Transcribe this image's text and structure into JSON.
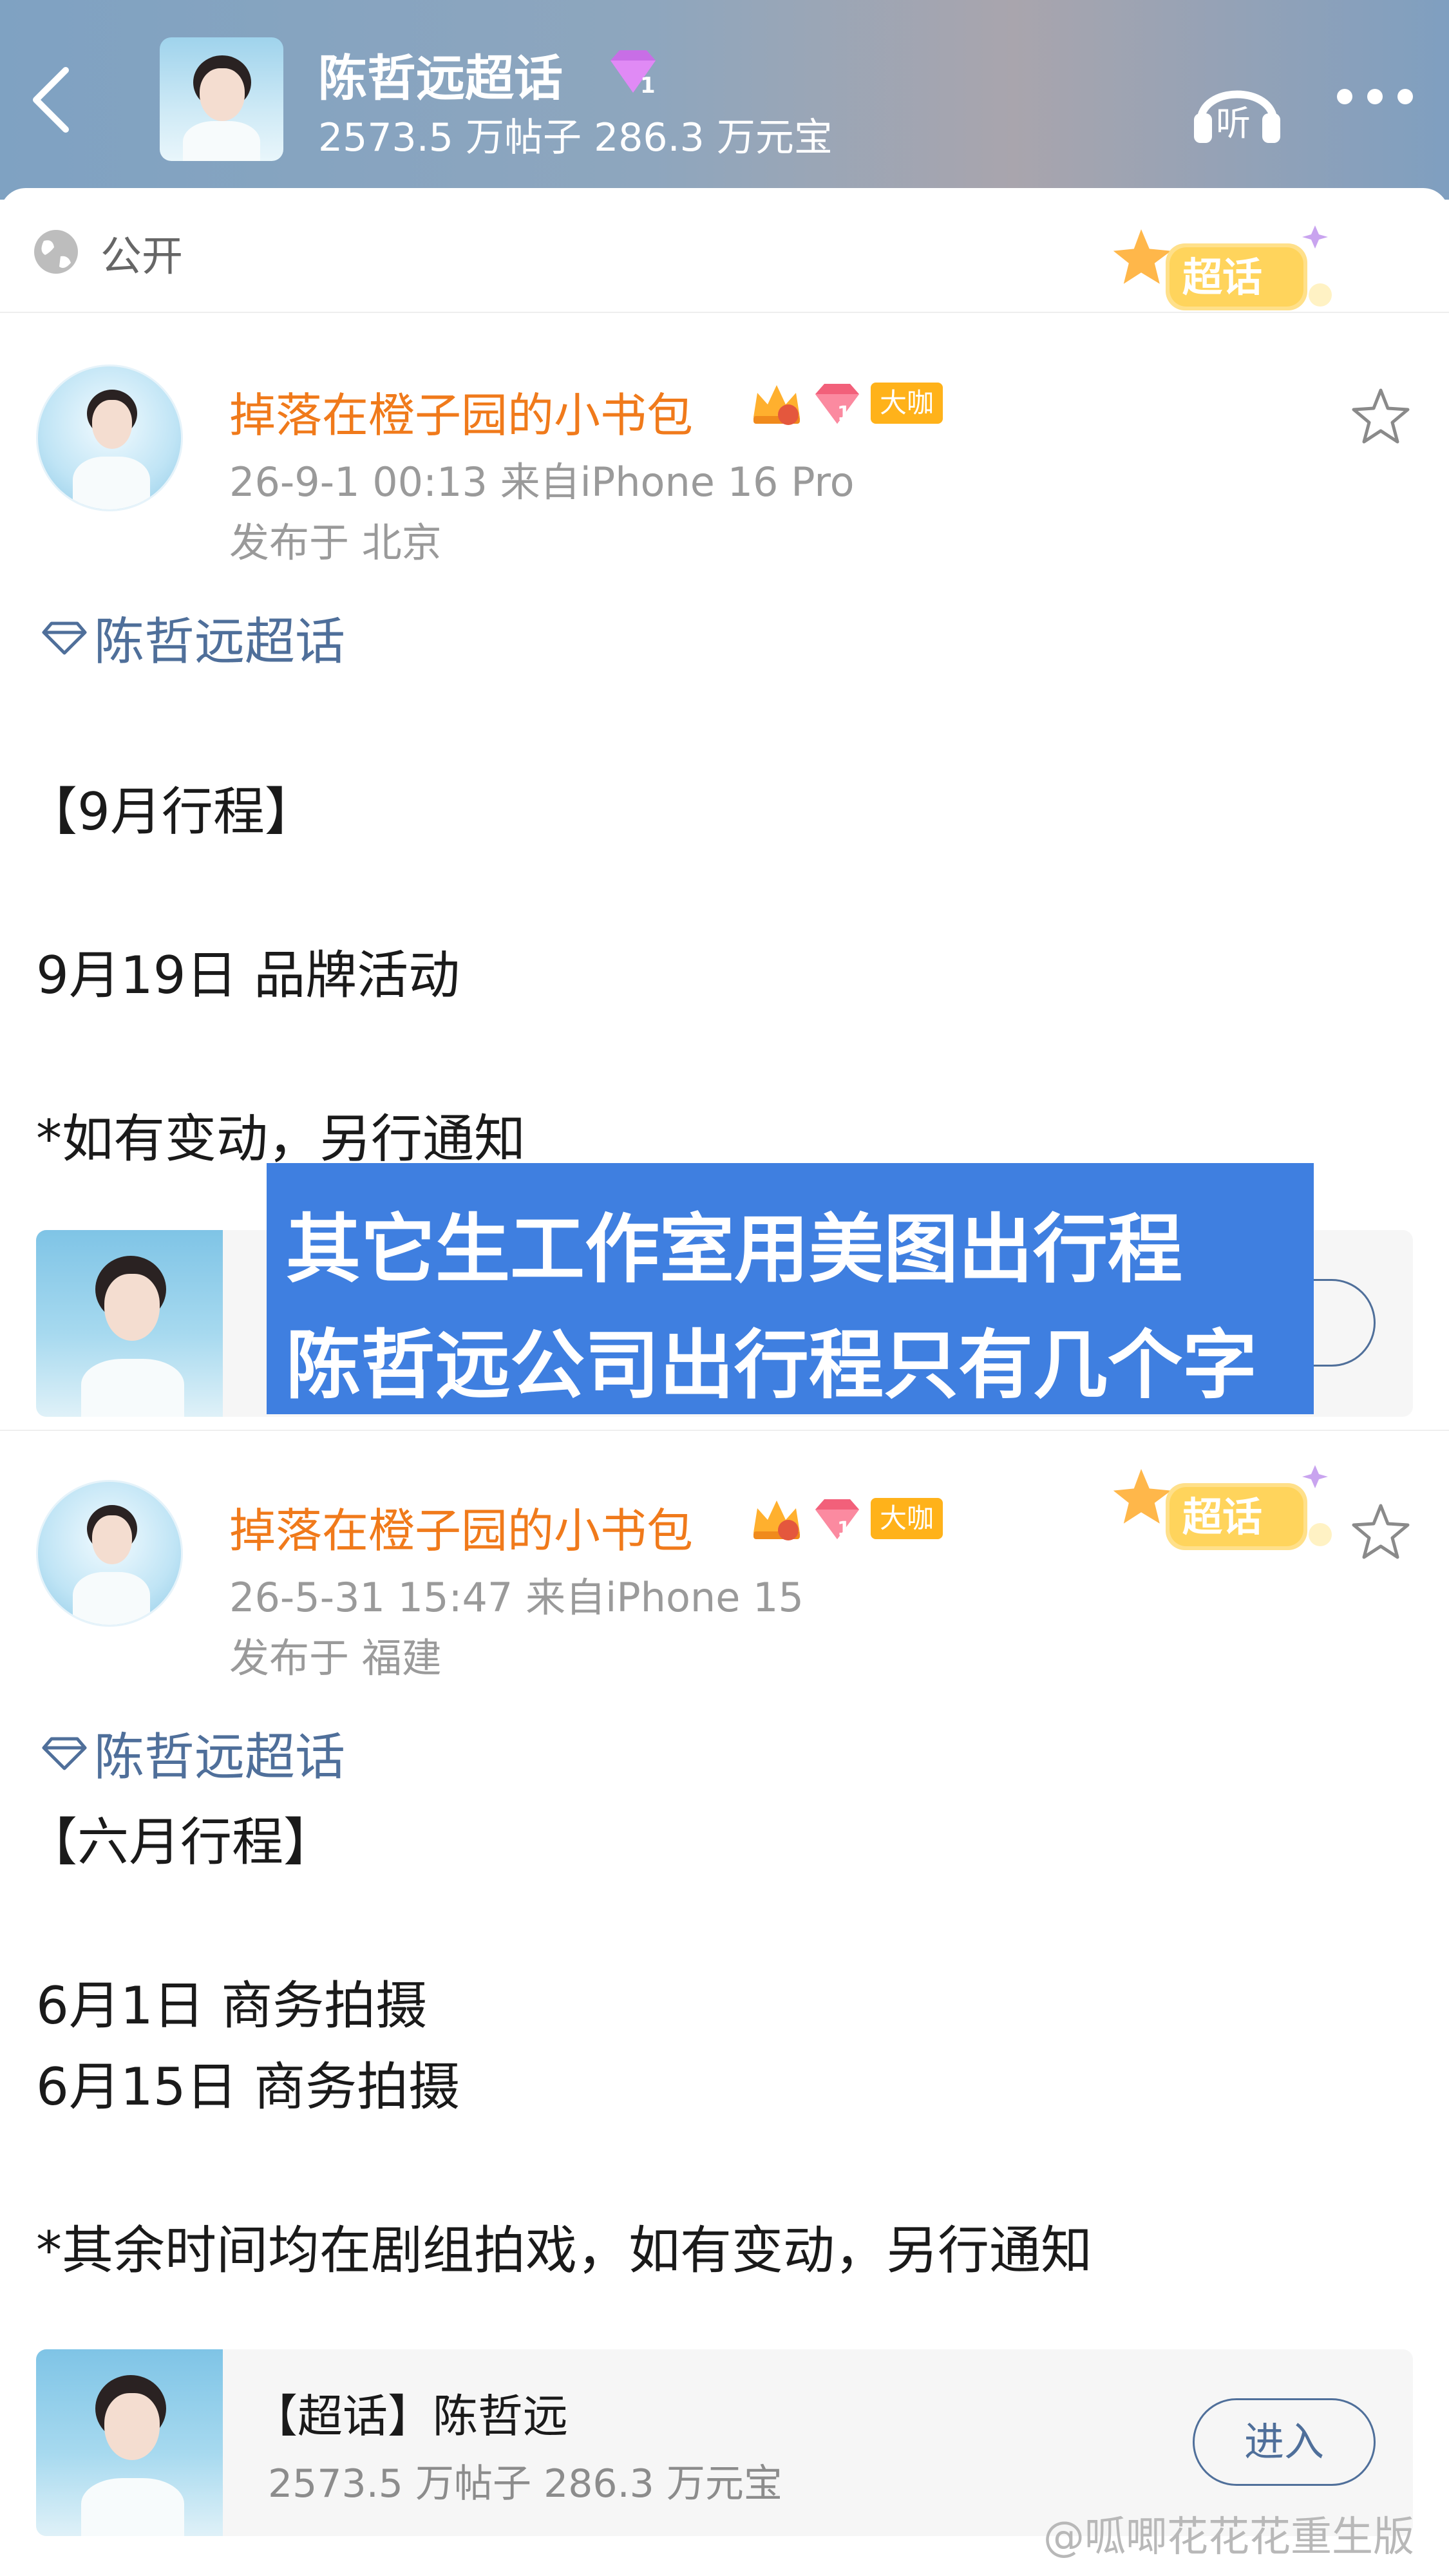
{
  "header": {
    "title": "陈哲远超话",
    "stats": "2573.5 万帖子 286.3 万元宝",
    "listen_label": "听"
  },
  "visibility": {
    "label": "公开"
  },
  "badge_label": "超话",
  "posts": [
    {
      "username": "掉落在橙子园的小书包",
      "level_tag": "大咖",
      "time_source": "26-9-1 00:13  来自iPhone 16 Pro",
      "location": "发布于 北京",
      "topic": "陈哲远超话",
      "lines": [
        "【9月行程】",
        "9月19日 品牌活动",
        "*如有变动，另行通知"
      ]
    },
    {
      "username": "掉落在橙子园的小书包",
      "level_tag": "大咖",
      "time_source": "26-5-31 15:47  来自iPhone 15",
      "location": "发布于 福建",
      "topic": "陈哲远超话",
      "lines": [
        "【六月行程】",
        "6月1日 商务拍摄",
        "6月15日 商务拍摄",
        "*其余时间均在剧组拍戏，如有变动，另行通知"
      ],
      "card": {
        "title": "【超话】陈哲远",
        "stats": "2573.5 万帖子 286.3 万元宝",
        "enter_label": "进入"
      }
    }
  ],
  "overlay": {
    "line1": "其它生工作室用美图出行程",
    "line2": "陈哲远公司出行程只有几个字"
  },
  "watermark": "@呱唧花花花重生版",
  "colors": {
    "username": "#f07a1b",
    "topic_link": "#4f6f9a",
    "overlay_bg": "#3f7fe0",
    "badge_tag": "#ffb21a"
  }
}
